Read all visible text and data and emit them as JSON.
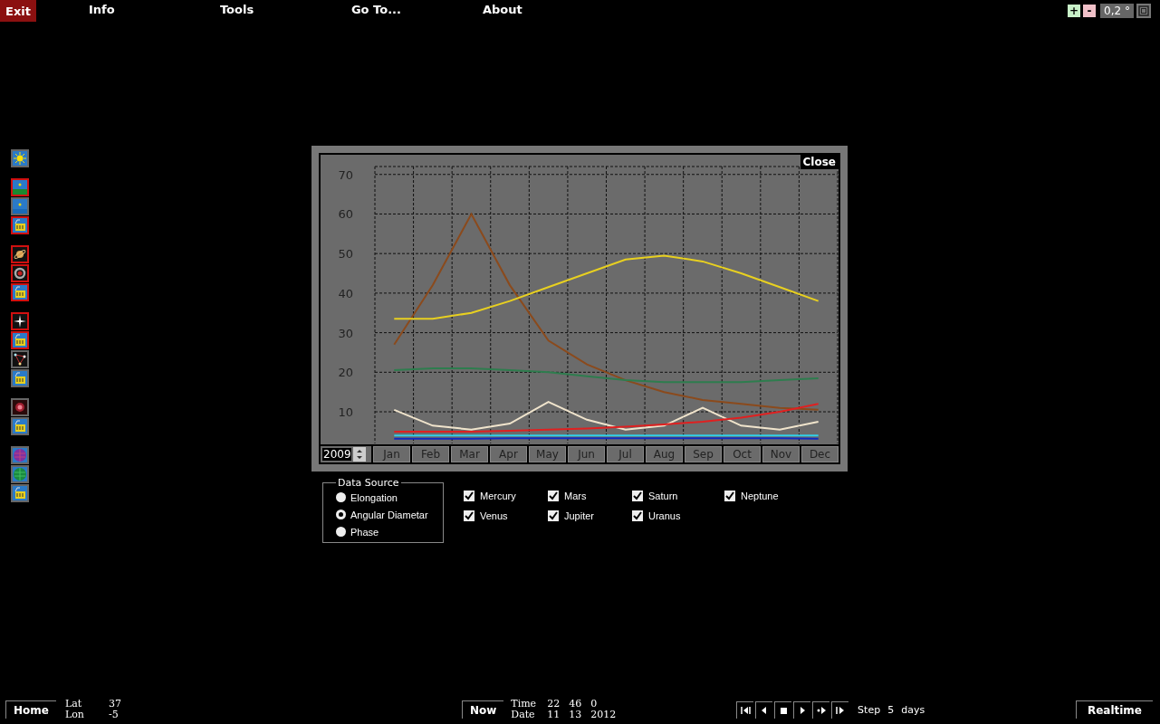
{
  "menu": {
    "exit": "Exit",
    "items": [
      "Info",
      "Tools",
      "Go To...",
      "About"
    ]
  },
  "view_controls": {
    "zoom_in": "+",
    "zoom_out": "-",
    "field_of_view": "0,2 °"
  },
  "toolbar_groups": [
    [
      {
        "kind": "sun",
        "on": false
      }
    ],
    [
      {
        "kind": "landscape",
        "on": true
      },
      {
        "kind": "sky",
        "on": false
      },
      {
        "kind": "counter",
        "on": true
      }
    ],
    [
      {
        "kind": "saturn",
        "on": true
      },
      {
        "kind": "ring",
        "on": true
      },
      {
        "kind": "counter",
        "on": true
      }
    ],
    [
      {
        "kind": "star",
        "on": true
      },
      {
        "kind": "counter",
        "on": true
      },
      {
        "kind": "constellation",
        "on": false
      },
      {
        "kind": "counter",
        "on": false
      }
    ],
    [
      {
        "kind": "nebula",
        "on": false
      },
      {
        "kind": "counter",
        "on": false
      }
    ],
    [
      {
        "kind": "planet",
        "on": false
      },
      {
        "kind": "globe",
        "on": false
      },
      {
        "kind": "counter",
        "on": false
      }
    ]
  ],
  "dialog": {
    "close": "Close",
    "year": "2009",
    "chart_data": {
      "type": "line",
      "grid": true,
      "categories": [
        "Jan",
        "Feb",
        "Mar",
        "Apr",
        "May",
        "Jun",
        "Jul",
        "Aug",
        "Sep",
        "Oct",
        "Nov",
        "Dec"
      ],
      "ylim": [
        2,
        72
      ],
      "yticks": [
        10,
        20,
        30,
        40,
        50,
        60,
        70
      ],
      "series": [
        {
          "color": "#8b4a1c",
          "values": [
            27,
            42,
            60,
            42,
            28,
            22,
            18,
            15,
            13,
            12,
            11,
            10.5
          ]
        },
        {
          "color": "#e8d020",
          "values": [
            33.5,
            33.5,
            35,
            38,
            41.5,
            45,
            48.5,
            49.5,
            48,
            45,
            41.5,
            38
          ]
        },
        {
          "color": "#2e7d4e",
          "values": [
            20.5,
            21,
            21,
            20.5,
            20,
            19,
            18,
            17.5,
            17.5,
            17.5,
            18,
            18.5
          ]
        },
        {
          "color": "#f0e4cc",
          "values": [
            10.5,
            6.5,
            5.5,
            7,
            12.5,
            8,
            5.5,
            6.5,
            11,
            6.5,
            5.5,
            7.5
          ]
        },
        {
          "color": "#e02020",
          "values": [
            5,
            5,
            5,
            5.2,
            5.5,
            5.8,
            6.2,
            6.8,
            7.5,
            8.5,
            10,
            12
          ]
        },
        {
          "color": "#30d0e8",
          "values": [
            4,
            4,
            4,
            4,
            4,
            4,
            4,
            4,
            4,
            4,
            4,
            4
          ]
        },
        {
          "color": "#1028c0",
          "values": [
            3.2,
            3.2,
            3.2,
            3.3,
            3.3,
            3.3,
            3.3,
            3.3,
            3.3,
            3.3,
            3.3,
            3.2
          ]
        }
      ]
    },
    "data_source": {
      "title": "Data Source",
      "options": [
        {
          "label": "Elongation",
          "selected": false
        },
        {
          "label": "Angular Diametar",
          "selected": true
        },
        {
          "label": "Phase",
          "selected": false
        }
      ]
    },
    "planets": [
      {
        "label": "Mercury",
        "checked": true
      },
      {
        "label": "Venus",
        "checked": true
      },
      {
        "label": "Mars",
        "checked": true
      },
      {
        "label": "Jupiter",
        "checked": true
      },
      {
        "label": "Saturn",
        "checked": true
      },
      {
        "label": "Uranus",
        "checked": true
      },
      {
        "label": "Neptune",
        "checked": true
      }
    ]
  },
  "status": {
    "home": "Home",
    "lat_label": "Lat",
    "lat": "37",
    "lon_label": "Lon",
    "lon": "-5",
    "now": "Now",
    "time_label": "Time",
    "time": [
      "22",
      "46",
      "0"
    ],
    "date_label": "Date",
    "date": [
      "11",
      "13",
      "2012"
    ],
    "transport": [
      {
        "kind": "skip-back"
      },
      {
        "kind": "back"
      },
      {
        "kind": "stop"
      },
      {
        "kind": "play"
      },
      {
        "kind": "fast"
      },
      {
        "kind": "skip-forward"
      }
    ],
    "step_label": "Step",
    "step": "5",
    "step_unit": "days",
    "realtime": "Realtime"
  }
}
